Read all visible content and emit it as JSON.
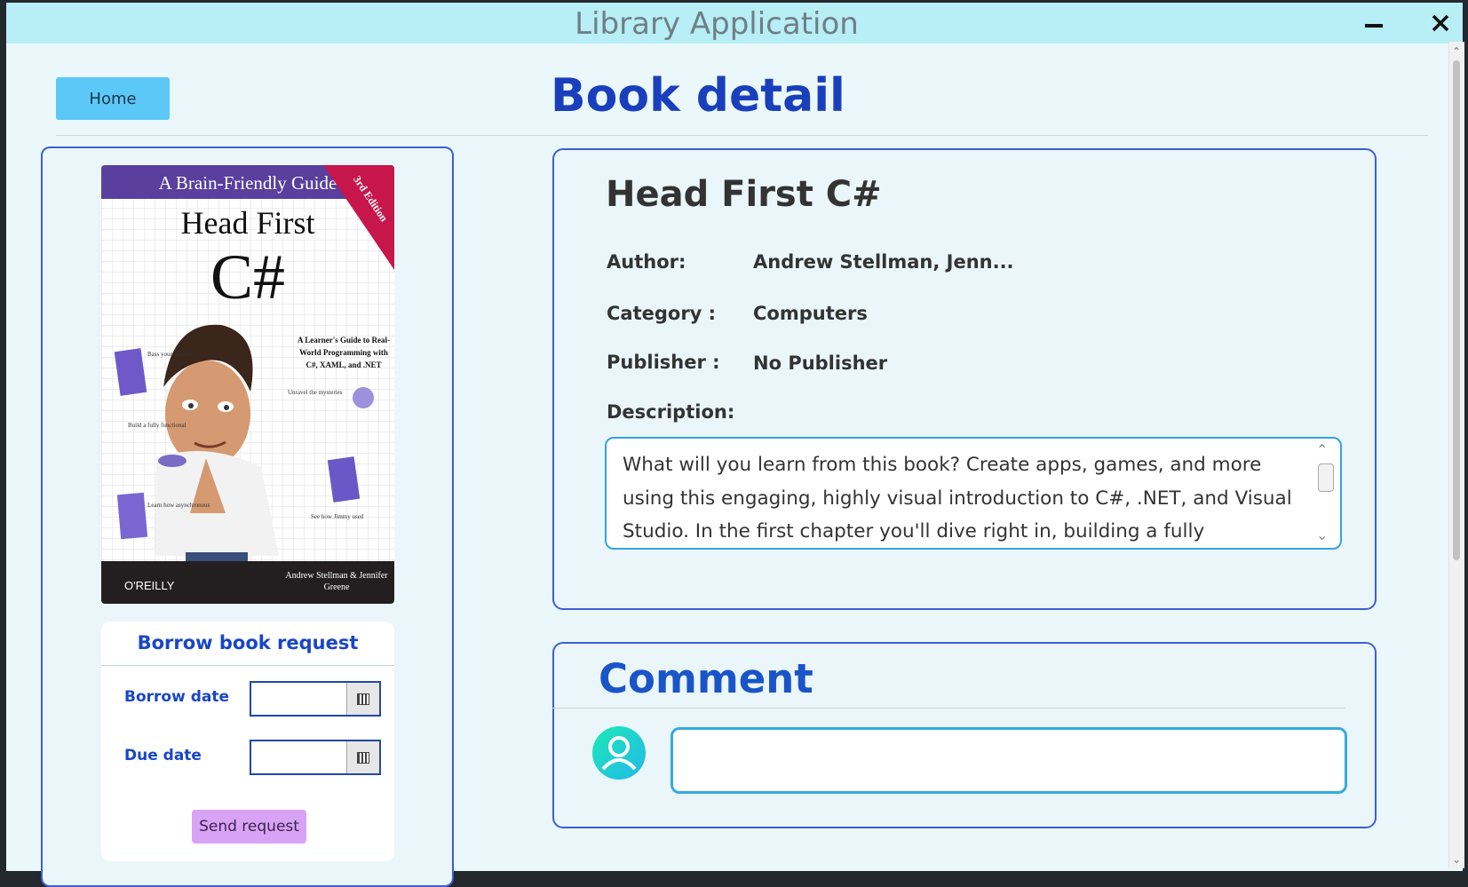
{
  "window": {
    "title": "Library Application"
  },
  "nav": {
    "home_label": "Home"
  },
  "page": {
    "title": "Book detail"
  },
  "cover": {
    "tagline": "A Brain-Friendly Guide",
    "title_line1": "Head First",
    "title_line2": "C#",
    "edition_badge": "3rd Edition",
    "subtitle": "A Learner's Guide to Real-World Programming with C#, XAML, and .NET",
    "publisher_logo": "O'REILLY",
    "authors": "Andrew Stellman & Jennifer Greene",
    "theme_color": "#5a3f9e",
    "badge_color": "#c7164b"
  },
  "borrow": {
    "title": "Borrow book request",
    "borrow_date_label": "Borrow date",
    "due_date_label": "Due date",
    "borrow_date_value": "",
    "due_date_value": "",
    "send_label": "Send request"
  },
  "book": {
    "title": "Head First C#",
    "author_label": "Author:",
    "author_value": "Andrew Stellman, Jenn...",
    "category_label": "Category :",
    "category_value": "Computers",
    "publisher_label": "Publisher :",
    "publisher_value": "No Publisher",
    "description_label": "Description:",
    "description": "What will you learn from this book? Create apps, games, and more using this engaging, highly visual introduction to C#, .NET, and Visual Studio. In the first chapter you'll dive right in, building a fully functional"
  },
  "comment": {
    "title": "Comment",
    "input_value": "",
    "input_placeholder": ""
  },
  "colors": {
    "accent": "#1a3fbc",
    "titlebar": "#b8eef5",
    "panel_border": "#3d5ed4",
    "home_button": "#5cc8f8",
    "send_button": "#d8a2f5"
  }
}
